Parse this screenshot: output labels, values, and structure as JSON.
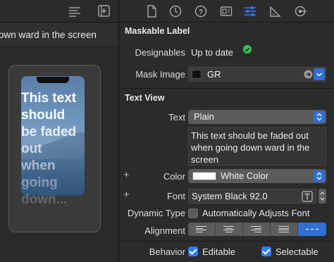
{
  "canvas": {
    "header_text": "own ward in the screen",
    "screen_lines": [
      "This text",
      "should",
      "be faded",
      "out",
      "when",
      "going",
      "down..."
    ]
  },
  "inspector": {
    "maskable_label": {
      "title": "Maskable Label",
      "designables_label": "Designables",
      "designables_value": "Up to date",
      "mask_image_label": "Mask Image",
      "mask_image_value": "GR"
    },
    "text_view": {
      "title": "Text View",
      "text_label": "Text",
      "text_type": "Plain",
      "text_content": "This text should be faded out when going down ward in the screen",
      "color_label": "Color",
      "color_value": "White Color",
      "font_label": "Font",
      "font_value": "System Black 92.0",
      "dynamic_type_label": "Dynamic Type",
      "dynamic_type_value": "Automatically Adjusts Font",
      "dynamic_type_checked": false,
      "alignment_label": "Alignment",
      "alignment_options": [
        "left",
        "center",
        "right",
        "justified",
        "natural"
      ],
      "alignment_selected": "natural",
      "behavior_label": "Behavior",
      "editable_label": "Editable",
      "editable_checked": true,
      "selectable_label": "Selectable",
      "selectable_checked": true
    }
  },
  "colors": {
    "accent": "#2f6fd6",
    "checkbox_on": "#2f7cf6",
    "status_green": "#34c759"
  }
}
